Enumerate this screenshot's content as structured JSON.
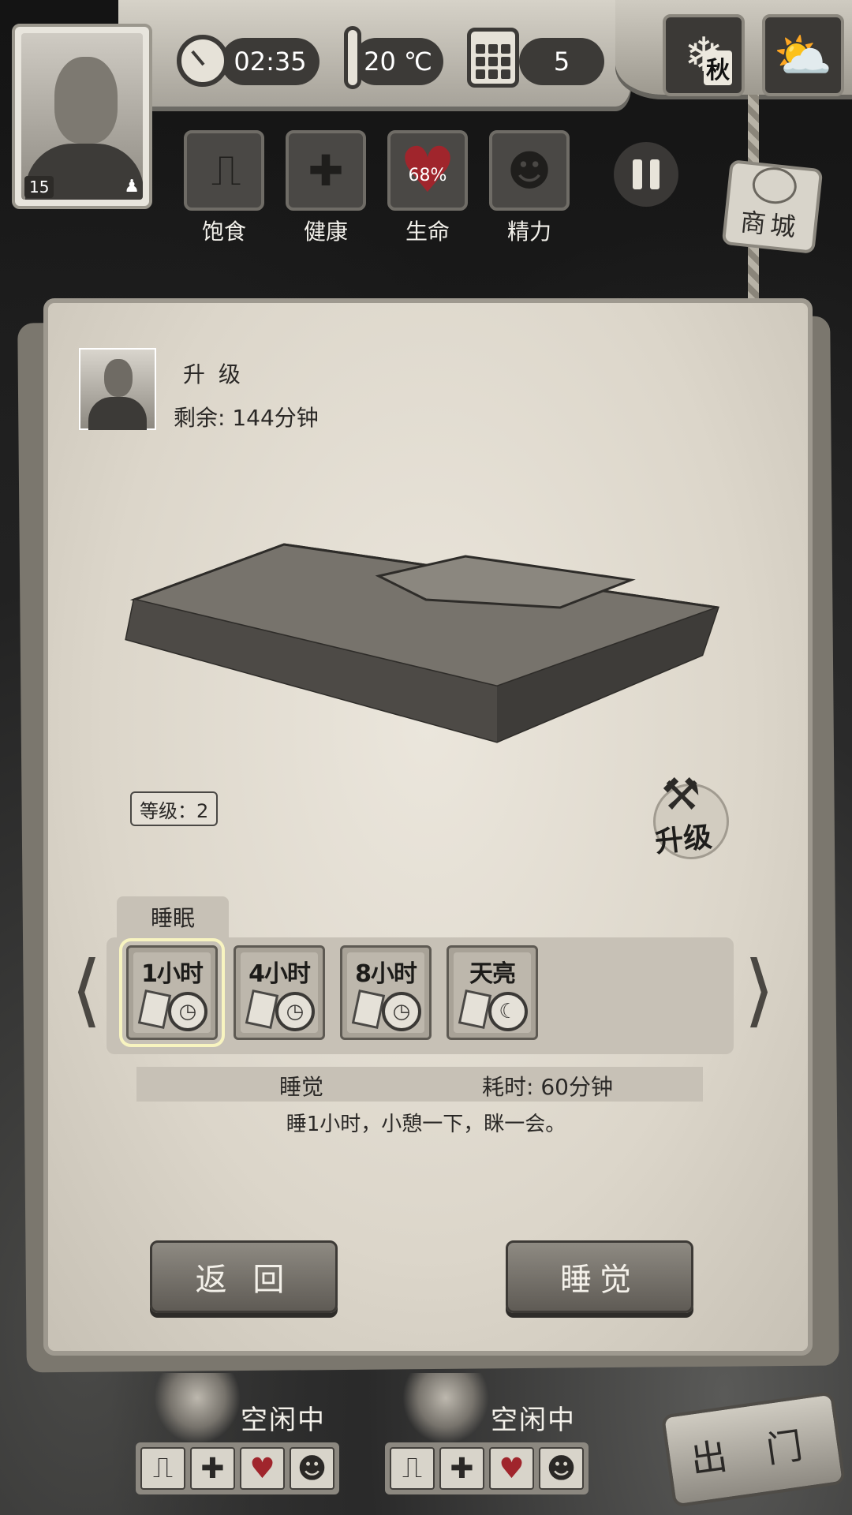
{
  "hud": {
    "character_level": "15",
    "time": "02:35",
    "temperature": "20 ℃",
    "day": "5",
    "season": "秋"
  },
  "needs": [
    {
      "label": "饱食",
      "icon": "stomach-icon"
    },
    {
      "label": "健康",
      "icon": "cross-icon"
    },
    {
      "label": "生命",
      "icon": "heart-icon",
      "value": "68%"
    },
    {
      "label": "精力",
      "icon": "head-icon"
    }
  ],
  "shop": {
    "label": "商城"
  },
  "task": {
    "title": "升 级",
    "remaining": "剩余: 144分钟"
  },
  "facility": {
    "level": "等级：2",
    "upgrade_label": "升级"
  },
  "sleep": {
    "tab_label": "睡眠",
    "options": [
      {
        "label": "1小时",
        "icon": "clock-icon",
        "selected": true
      },
      {
        "label": "4小时",
        "icon": "clock-icon",
        "selected": false
      },
      {
        "label": "8小时",
        "icon": "clock-icon",
        "selected": false
      },
      {
        "label": "天亮",
        "icon": "moon-icon",
        "selected": false
      }
    ],
    "action": "睡觉",
    "cost": "耗时: 60分钟",
    "description": "睡1小时，小憩一下，眯一会。"
  },
  "buttons": {
    "back": "返 回",
    "sleep": "睡觉"
  },
  "crew": [
    {
      "status": "空闲中"
    },
    {
      "status": "空闲中"
    }
  ],
  "exit_label": "出 门",
  "colors": {
    "health_red": "#a0252c",
    "paper": "#e3ded3",
    "wood_dark": "#3b3936"
  }
}
